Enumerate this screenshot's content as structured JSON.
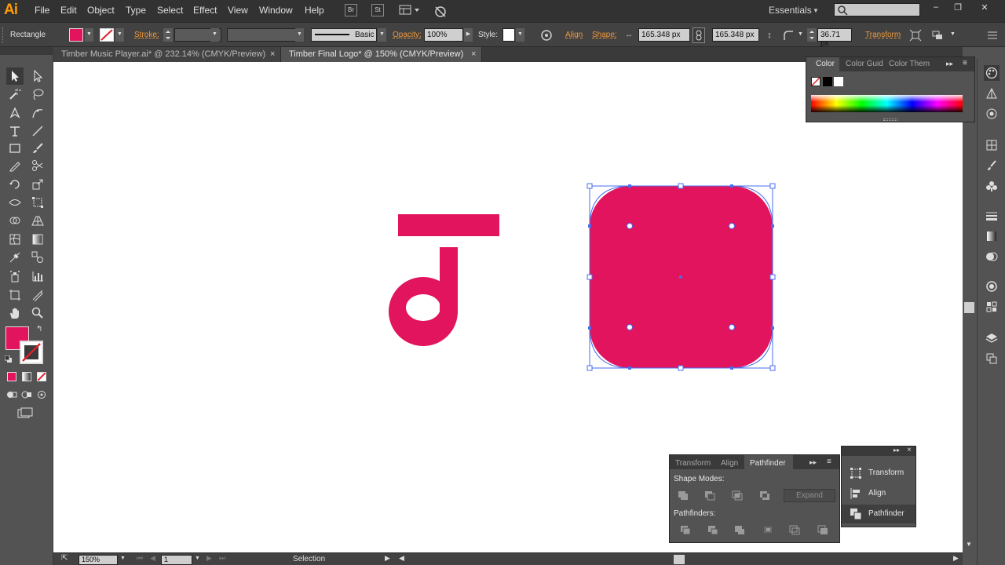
{
  "app": {
    "logo": "Ai",
    "menu": [
      "File",
      "Edit",
      "Object",
      "Type",
      "Select",
      "Effect",
      "View",
      "Window",
      "Help"
    ],
    "bridge_btn": "Br",
    "stock_btn": "St",
    "workspace": "Essentials",
    "window_controls": [
      "–",
      "❐",
      "✕"
    ]
  },
  "control_bar": {
    "tool_name": "Rectangle",
    "fill_color": "#e2145e",
    "stroke_label": "Stroke:",
    "stroke_profile": "Basic",
    "opacity_label": "Opacity:",
    "opacity_value": "100%",
    "style_label": "Style:",
    "align_label": "Align",
    "shape_label": "Shape:",
    "width_value": "165.348 px",
    "height_value": "165.348 px",
    "corner_value": "36.71 px",
    "transform_label": "Transform"
  },
  "tabs": [
    {
      "title": "Timber Music Player.ai* @ 232.14% (CMYK/Preview)",
      "active": false
    },
    {
      "title": "Timber Final Logo* @ 150% (CMYK/Preview)",
      "active": true
    }
  ],
  "color_panel": {
    "tabs": [
      "Color",
      "Color Guid",
      "Color Them"
    ]
  },
  "pathfinder_panel": {
    "tabs": [
      "Transform",
      "Align",
      "Pathfinder"
    ],
    "shape_modes_label": "Shape Modes:",
    "pathfinders_label": "Pathfinders:",
    "expand_label": "Expand"
  },
  "mini_panel": {
    "items": [
      "Transform",
      "Align",
      "Pathfinder"
    ]
  },
  "status_bar": {
    "zoom": "150%",
    "artboard": "1",
    "tool": "Selection"
  },
  "colors": {
    "artwork": "#e2145e",
    "selection": "#4a6cf0"
  }
}
